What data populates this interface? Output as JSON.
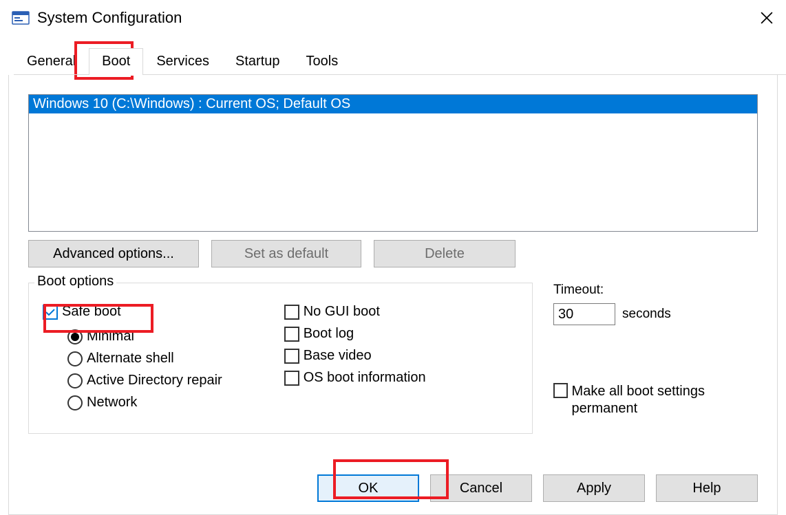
{
  "window": {
    "title": "System Configuration"
  },
  "tabs": {
    "general": "General",
    "boot": "Boot",
    "services": "Services",
    "startup": "Startup",
    "tools": "Tools",
    "active": "boot"
  },
  "os_list": {
    "entry": "Windows 10 (C:\\Windows) : Current OS; Default OS"
  },
  "buttons": {
    "advanced": "Advanced options...",
    "set_default": "Set as default",
    "delete": "Delete"
  },
  "boot_options": {
    "legend": "Boot options",
    "safe_boot": {
      "label": "Safe boot",
      "checked": true
    },
    "safe_modes": {
      "minimal": "Minimal",
      "alternate_shell": "Alternate shell",
      "ad_repair": "Active Directory repair",
      "network": "Network",
      "selected": "minimal"
    },
    "no_gui": {
      "label": "No GUI boot",
      "checked": false
    },
    "boot_log": {
      "label": "Boot log",
      "checked": false
    },
    "base_video": {
      "label": "Base video",
      "checked": false
    },
    "os_boot_info": {
      "label": "OS boot information",
      "checked": false
    }
  },
  "timeout": {
    "label": "Timeout:",
    "value": "30",
    "unit": "seconds"
  },
  "make_permanent": {
    "label": "Make all boot settings permanent",
    "checked": false
  },
  "dialog_buttons": {
    "ok": "OK",
    "cancel": "Cancel",
    "apply": "Apply",
    "help": "Help"
  }
}
